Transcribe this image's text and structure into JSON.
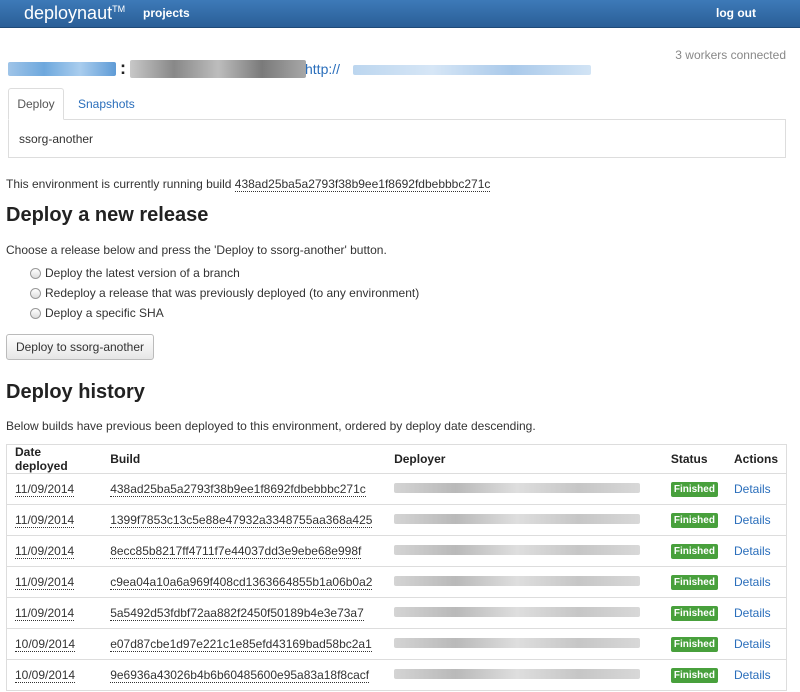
{
  "nav": {
    "brand": "deploynaut",
    "brand_sup": "TM",
    "projects": "projects",
    "logout": "log out"
  },
  "status": {
    "workers": "3 workers connected"
  },
  "header": {
    "separator": ":",
    "url_prefix": "http://"
  },
  "tabs": {
    "deploy": "Deploy",
    "snapshots": "Snapshots",
    "panel_text": "ssorg-another"
  },
  "running": {
    "text": "This environment is currently running build ",
    "sha": "438ad25ba5a2793f38b9ee1f8692fdbebbbc271c"
  },
  "deploy_section": {
    "title": "Deploy a new release",
    "instructions": "Choose a release below and press the 'Deploy to ssorg-another' button.",
    "options": [
      "Deploy the latest version of a branch",
      "Redeploy a release that was previously deployed (to any environment)",
      "Deploy a specific SHA"
    ],
    "button": "Deploy to ssorg-another"
  },
  "history": {
    "title": "Deploy history",
    "description": "Below builds have previous been deployed to this environment, ordered by deploy date descending.",
    "columns": [
      "Date deployed",
      "Build",
      "Deployer",
      "Status",
      "Actions"
    ],
    "rows": [
      {
        "date": "11/09/2014",
        "build": "438ad25ba5a2793f38b9ee1f8692fdbebbbc271c",
        "status": "Finished",
        "action": "Details"
      },
      {
        "date": "11/09/2014",
        "build": "1399f7853c13c5e88e47932a3348755aa368a425",
        "status": "Finished",
        "action": "Details"
      },
      {
        "date": "11/09/2014",
        "build": "8ecc85b8217ff4711f7e44037dd3e9ebe68e998f",
        "status": "Finished",
        "action": "Details"
      },
      {
        "date": "11/09/2014",
        "build": "c9ea04a10a6a969f408cd1363664855b1a06b0a2",
        "status": "Finished",
        "action": "Details"
      },
      {
        "date": "11/09/2014",
        "build": "5a5492d53fdbf72aa882f2450f50189b4e3e73a7",
        "status": "Finished",
        "action": "Details"
      },
      {
        "date": "10/09/2014",
        "build": "e07d87cbe1d97e221c1e85efd43169bad58bc2a1",
        "status": "Finished",
        "action": "Details"
      },
      {
        "date": "10/09/2014",
        "build": "9e6936a43026b4b6b60485600e95a83a18f8cacf",
        "status": "Finished",
        "action": "Details"
      }
    ]
  },
  "colors": {
    "nav": "#2a5f97",
    "link": "#2a6ebb",
    "badge": "#48a03c"
  }
}
